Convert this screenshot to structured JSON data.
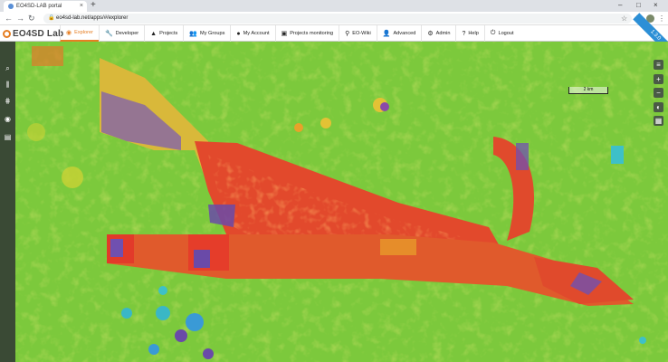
{
  "browser": {
    "tab_title": "EO4SD-LAB portal",
    "tab_close": "×",
    "new_tab": "+",
    "url": "eo4sd-lab.net/apps/#/explorer",
    "lock": "🔒",
    "nav_back": "←",
    "nav_forward": "→",
    "nav_reload": "↻",
    "win_min": "–",
    "win_max": "□",
    "win_close": "×",
    "star": "☆",
    "menu": "⋮"
  },
  "app": {
    "logo_text": "EO4SD Lab",
    "version_ribbon": "1.3.0",
    "nav": [
      {
        "label": "Explorer",
        "icon": "◉",
        "active": true
      },
      {
        "label": "Developer",
        "icon": "🔧"
      },
      {
        "label": "Projects",
        "icon": "▲"
      },
      {
        "label": "My Groups",
        "icon": "👥"
      },
      {
        "label": "My Account",
        "icon": "●"
      },
      {
        "label": "Projects monitoring",
        "icon": "▣"
      },
      {
        "label": "EO-Wiki",
        "icon": "⚲"
      },
      {
        "label": "Advanced",
        "icon": "👤"
      },
      {
        "label": "Admin",
        "icon": "⚙"
      },
      {
        "label": "Help",
        "icon": "?"
      },
      {
        "label": "Logout",
        "icon": "⏻"
      }
    ]
  },
  "map": {
    "scale_label": "2 km",
    "sidebar_icons": [
      "search-icon",
      "services-icon",
      "workflow-icon",
      "visibility-icon",
      "jobs-icon"
    ],
    "sidebar_glyphs": [
      "⌕",
      "⫼",
      "⋕",
      "◉",
      "▤"
    ],
    "controls": [
      "layers-icon",
      "zoom-in-icon",
      "zoom-out-icon",
      "basemap-icon",
      "overlay-icon"
    ],
    "control_glyphs": [
      "≡",
      "+",
      "−",
      "◐",
      "▦"
    ]
  }
}
